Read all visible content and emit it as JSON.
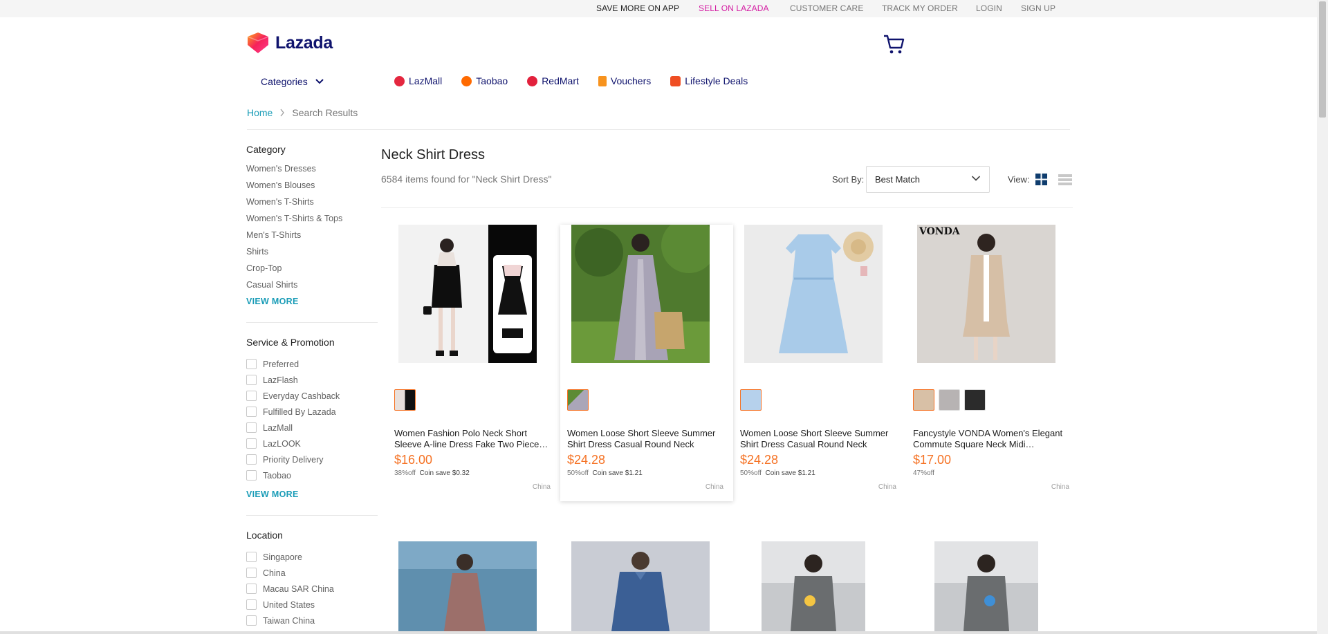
{
  "topbar": {
    "save_app": "SAVE MORE ON APP",
    "sell": "SELL ON LAZADA",
    "care": "CUSTOMER CARE",
    "track": "TRACK MY ORDER",
    "login": "LOGIN",
    "signup": "SIGN UP"
  },
  "header": {
    "logo_text": "Lazada",
    "categories": "Categories",
    "nav": [
      "LazMall",
      "Taobao",
      "RedMart",
      "Vouchers",
      "Lifestyle Deals"
    ]
  },
  "breadcrumb": {
    "home": "Home",
    "current": "Search Results"
  },
  "sidebar": {
    "category_title": "Category",
    "categories": [
      "Women's Dresses",
      "Women's Blouses",
      "Women's T-Shirts",
      "Women's T-Shirts & Tops",
      "Men's T-Shirts",
      "Shirts",
      "Crop-Top",
      "Casual Shirts"
    ],
    "view_more": "VIEW MORE",
    "service_title": "Service & Promotion",
    "services": [
      "Preferred",
      "LazFlash",
      "Everyday Cashback",
      "Fulfilled By Lazada",
      "LazMall",
      "LazLOOK",
      "Priority Delivery",
      "Taobao"
    ],
    "location_title": "Location",
    "locations": [
      "Singapore",
      "China",
      "Macau SAR China",
      "United States",
      "Taiwan China"
    ]
  },
  "results": {
    "title": "Neck Shirt Dress",
    "count": "6584 items found for \"Neck Shirt Dress\"",
    "sort_label": "Sort By:",
    "sort_value": "Best Match",
    "view_label": "View:"
  },
  "products": [
    {
      "name": "Women Fashion Polo Neck Short Sleeve A-line Dress Fake Two Piece…",
      "price": "$16.00",
      "discount": "38%off",
      "coin": "Coin save $0.32",
      "origin": "China"
    },
    {
      "name": "Women Loose Short Sleeve Summer Shirt Dress Casual Round Neck Plus…",
      "price": "$24.28",
      "discount": "50%off",
      "coin": "Coin save $1.21",
      "origin": "China"
    },
    {
      "name": "Women Loose Short Sleeve Summer Shirt Dress Casual Round Neck Plus…",
      "price": "$24.28",
      "discount": "50%off",
      "coin": "Coin save $1.21",
      "origin": "China"
    },
    {
      "name": "Fancystyle VONDA Women's Elegant Commute Square Neck Midi…",
      "price": "$17.00",
      "discount": "47%off",
      "coin": "",
      "origin": "China",
      "brand_mark": "VONDA"
    }
  ],
  "colors": {
    "accent": "#f57224",
    "brand_navy": "#0f136d",
    "link_blue": "#1a9cb7",
    "sell_pink": "#d41ea3"
  }
}
